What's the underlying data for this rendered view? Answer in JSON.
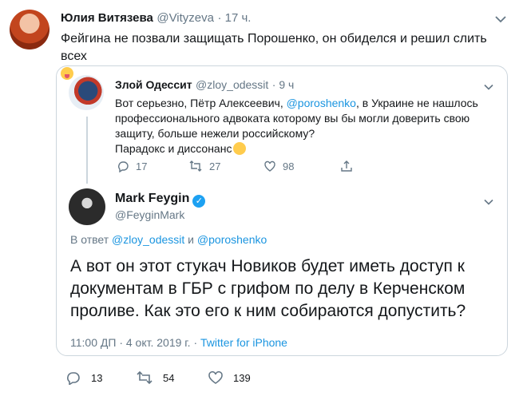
{
  "main_tweet": {
    "name": "Юлия Витязева",
    "handle": "@Vityzeva",
    "time": "· 17 ч.",
    "text": "Фейгина не позвали защищать Порошенко, он обиделся и решил слить всех",
    "emoji": "squinting-face-with-tongue",
    "actions": {
      "replies": "13",
      "retweets": "54",
      "likes": "139"
    }
  },
  "quoted_parent": {
    "name": "Злой Одессит",
    "handle": "@zloy_odessit",
    "time": "· 9 ч",
    "text_line1_pre": "Вот серьезно, Пётр Алексеевич, ",
    "mention": "@poroshenko",
    "text_line1_post": ", в Украине не нашлось",
    "text_line2": "профессионального адвоката которому вы бы могли доверить свою",
    "text_line3": "защиту, больше нежели российскому?",
    "text_line4": "Парадокс и диссонанс",
    "emoji": "thinking-face",
    "actions": {
      "replies": "17",
      "retweets": "27",
      "likes": "98"
    }
  },
  "quoted_reply": {
    "name": "Mark Feygin",
    "handle": "@FeyginMark",
    "reply_prefix": "В ответ ",
    "reply_user1": "@zloy_odessit",
    "reply_and": " и ",
    "reply_user2": "@poroshenko",
    "text_line1": "А вот он этот стукач Новиков будет иметь доступ к",
    "text_line2": "документам в ГБР с грифом по делу в Керченском",
    "text_line3": "проливе. Как это его к ним собираются допустить?",
    "timestamp": "11:00 ДП · 4 окт. 2019 г. · ",
    "source": "Twitter for iPhone"
  },
  "colors": {
    "link": "#1b95e0",
    "secondary": "#657786",
    "border": "#ccd6dd",
    "verified": "#1da1f2"
  }
}
